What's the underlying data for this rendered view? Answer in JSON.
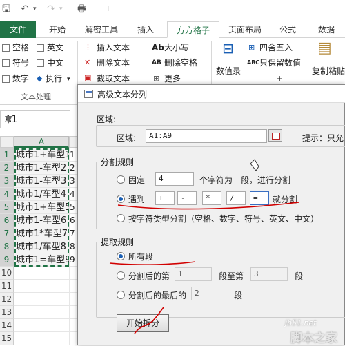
{
  "qat": {
    "save": "🖫",
    "undo": "↶",
    "undo_dd": "▾",
    "redo": "↷",
    "redo_dd": "▾",
    "print": "🖶",
    "customize": "⊤"
  },
  "tabs": [
    {
      "label": "文件"
    },
    {
      "label": "开始"
    },
    {
      "label": "解密工具"
    },
    {
      "label": "插入"
    },
    {
      "label": "方方格子"
    },
    {
      "label": "页面布局"
    },
    {
      "label": "公式"
    },
    {
      "label": "数据"
    }
  ],
  "ribbon": {
    "checkboxes": [
      {
        "label": "空格"
      },
      {
        "label": "英文"
      },
      {
        "label": "符号"
      },
      {
        "label": "中文"
      },
      {
        "label": "数字"
      }
    ],
    "execute": "执行",
    "group_text": "文本处理",
    "insert_text": "插入文本",
    "delete_text": "删除文本",
    "extract_text": "截取文本",
    "case": "大小写",
    "delete_space": "删除空格",
    "more": "更多",
    "value_record": "数值录",
    "round": "四舍五入",
    "keep_value": "只保留数值",
    "copy_paste": "复制粘贴",
    "case_icon": "Ab",
    "del_space_icon": "AB",
    "round_icon": "⊞",
    "keep_icon": "ABC",
    "more_icon": "⊞",
    "plus": "+"
  },
  "namebox": {
    "value": "A1"
  },
  "sheet": {
    "col_a": "A",
    "rows": [
      {
        "n": "1",
        "a": "城市1+车型1",
        "b": "1"
      },
      {
        "n": "2",
        "a": "城市1-车型2",
        "b": "2"
      },
      {
        "n": "3",
        "a": "城市1-车型3",
        "b": "3"
      },
      {
        "n": "4",
        "a": "城市1/车型4",
        "b": "4"
      },
      {
        "n": "5",
        "a": "城市1+车型5",
        "b": "5"
      },
      {
        "n": "6",
        "a": "城市1-车型6",
        "b": "6"
      },
      {
        "n": "7",
        "a": "城市1*车型7",
        "b": "7"
      },
      {
        "n": "8",
        "a": "城市1/车型8",
        "b": "8"
      },
      {
        "n": "9",
        "a": "城市1=车型9",
        "b": "9"
      },
      {
        "n": "10",
        "a": "",
        "b": ""
      },
      {
        "n": "11",
        "a": "",
        "b": ""
      },
      {
        "n": "12",
        "a": "",
        "b": ""
      },
      {
        "n": "13",
        "a": "",
        "b": ""
      },
      {
        "n": "14",
        "a": "",
        "b": ""
      },
      {
        "n": "15",
        "a": "",
        "b": ""
      }
    ]
  },
  "dialog": {
    "title": "高级文本分列",
    "region_legend": "区域:",
    "region_label": "区域:",
    "region_value": "A1:A9",
    "hint": "提示：只允",
    "split_legend": "分割规则",
    "fixed_label": "固定",
    "fixed_value": "4",
    "fixed_suffix": "个字符为一段，进行分割",
    "meet_label": "遇到",
    "delims": [
      "+",
      "-",
      "*",
      "/",
      "="
    ],
    "meet_suffix": "就分割",
    "by_type": "按字符类型分割（空格、数字、符号、英文、中文）",
    "extract_legend": "提取规则",
    "all_segments": "所有段",
    "after_n": "分割后的第",
    "after_from": "1",
    "segment_to": "段至第",
    "after_to": "3",
    "segment": "段",
    "last_n": "分割后的最后的",
    "last_value": "2",
    "last_segment": "段",
    "start_button": "开始拆分"
  },
  "watermark": {
    "site": "jb51.net",
    "name": "脚本之家"
  },
  "colors": {
    "excel_green": "#217346",
    "annotation_red": "#d10000"
  }
}
